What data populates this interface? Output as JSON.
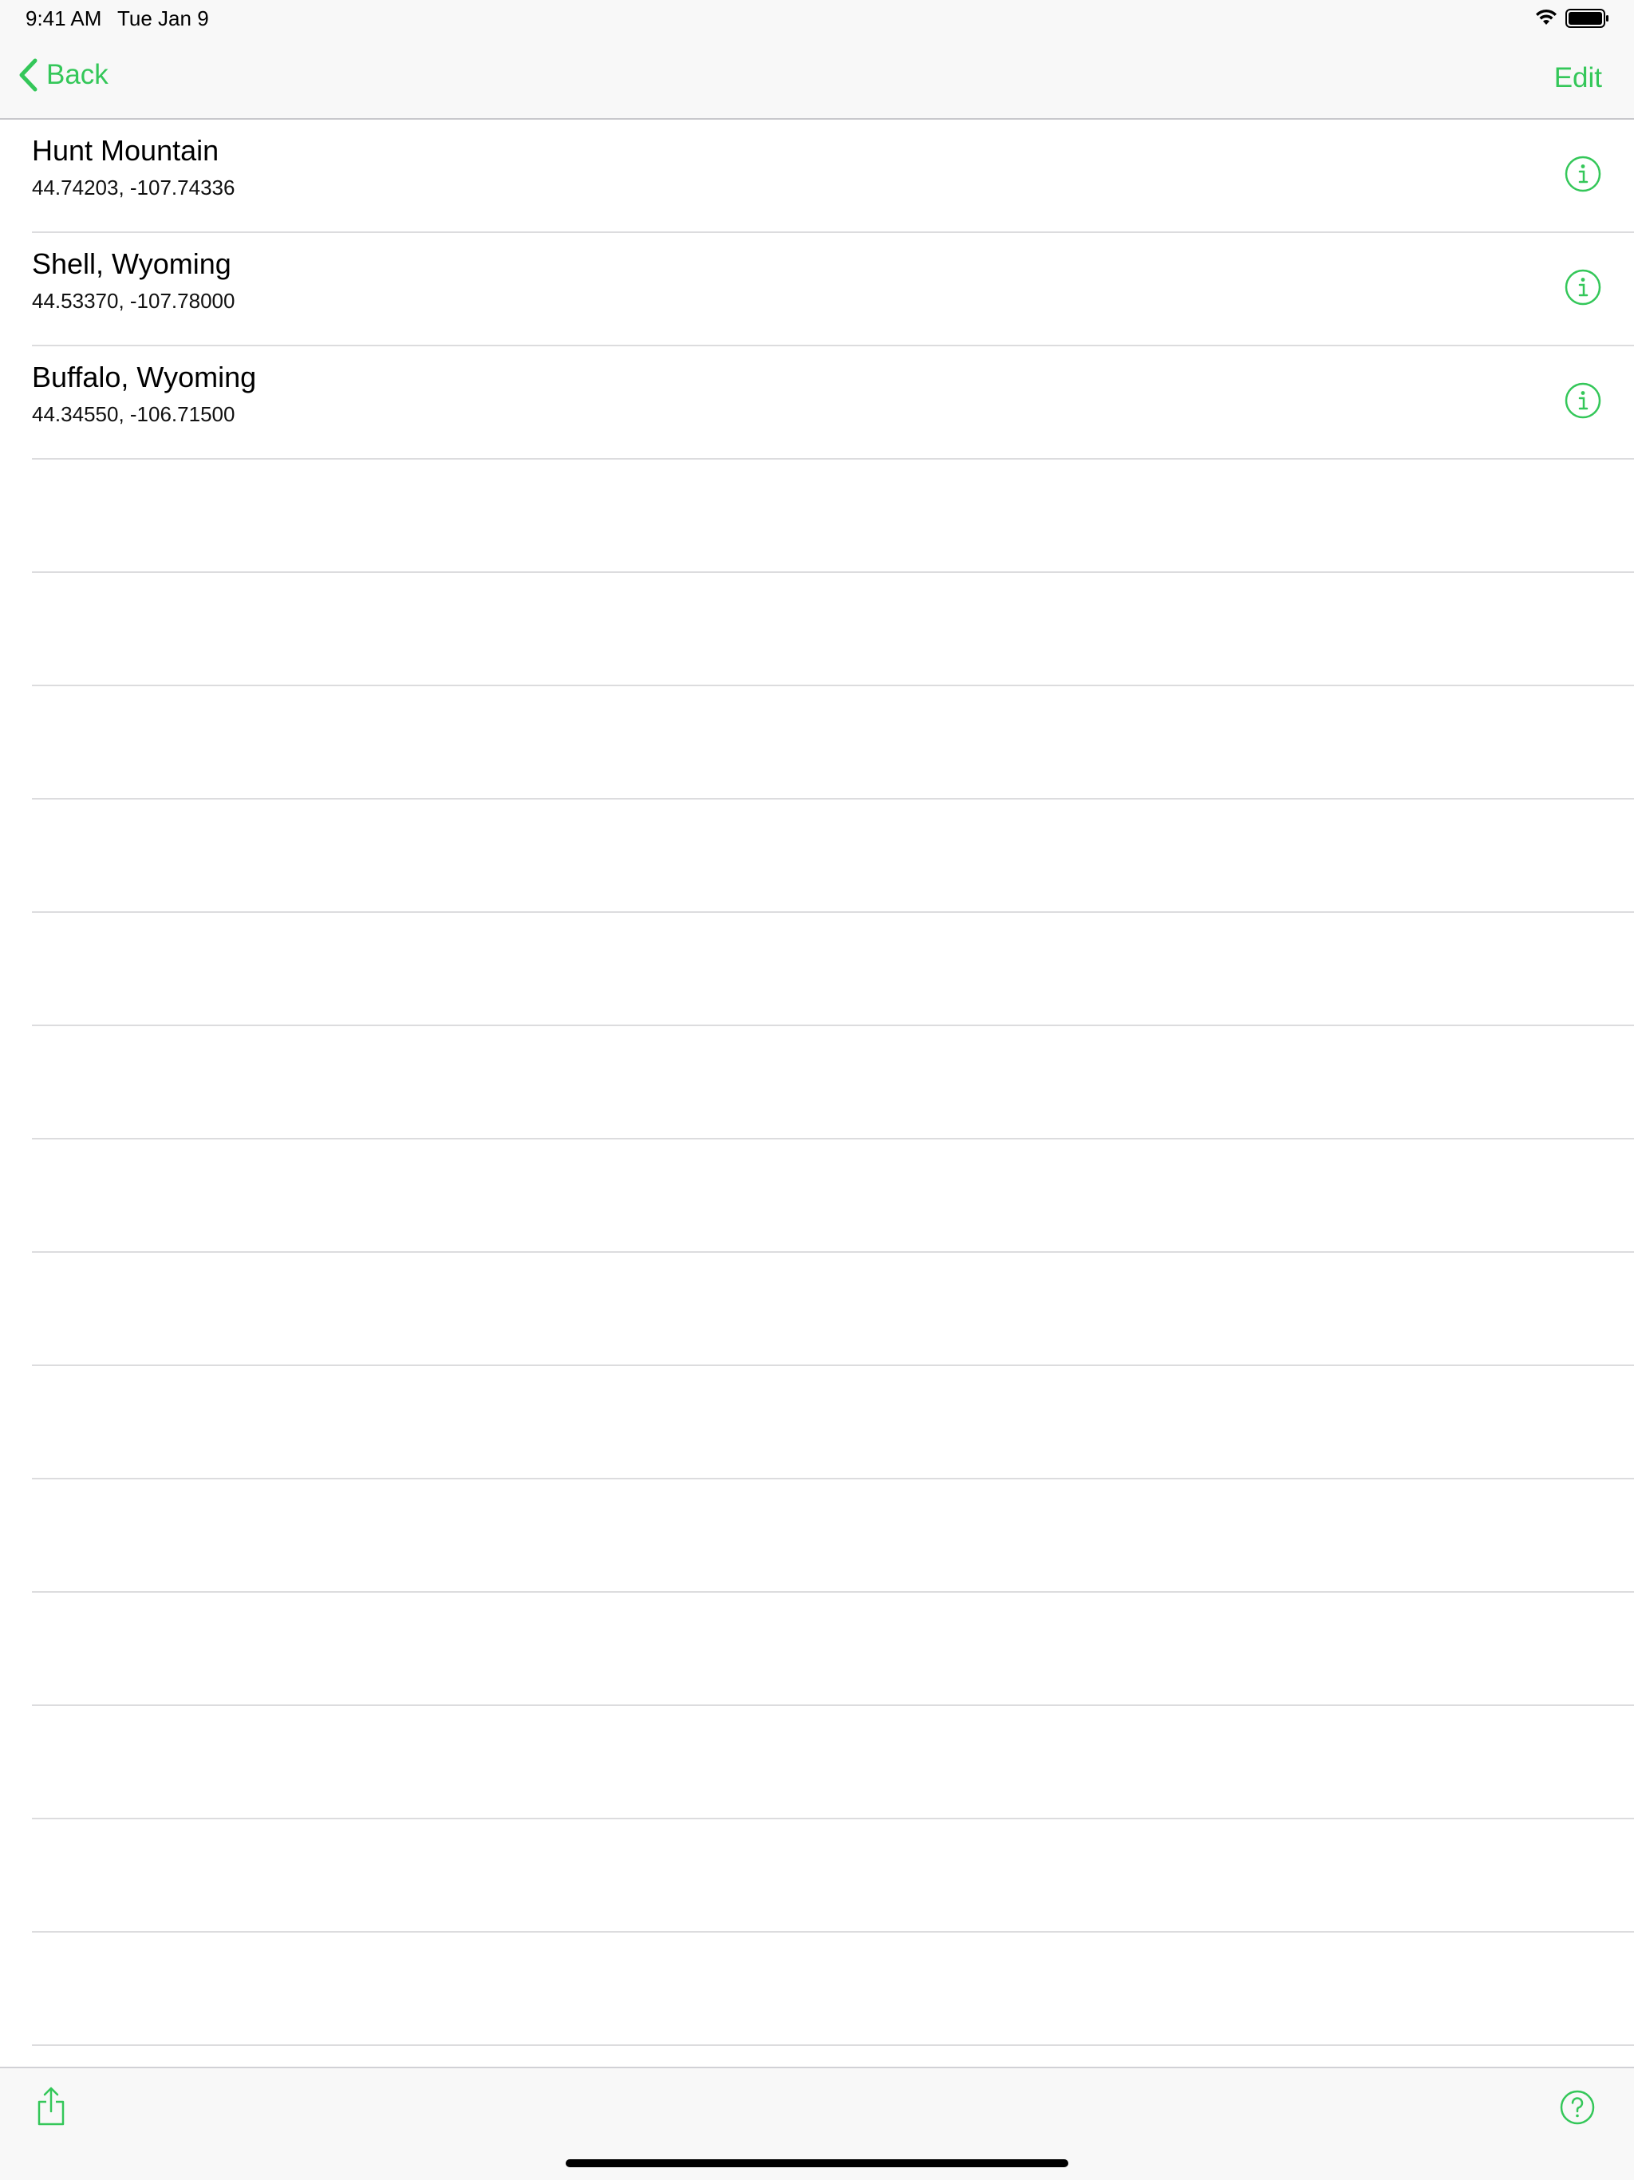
{
  "status_bar": {
    "time": "9:41 AM",
    "date": "Tue Jan 9",
    "wifi_icon": "wifi-icon",
    "battery_icon": "battery-full-icon"
  },
  "nav_bar": {
    "back_label": "Back",
    "edit_label": "Edit"
  },
  "locations": [
    {
      "name": "Hunt Mountain",
      "coordinates": "44.74203, -107.74336"
    },
    {
      "name": "Shell, Wyoming",
      "coordinates": "44.53370, -107.78000"
    },
    {
      "name": "Buffalo, Wyoming",
      "coordinates": "44.34550, -106.71500"
    }
  ],
  "toolbar": {
    "share_icon": "share-icon",
    "help_icon": "question-circle-icon"
  },
  "colors": {
    "accent": "#34c759",
    "separator": "#dcdcde",
    "bar_background": "#f8f8f8"
  }
}
